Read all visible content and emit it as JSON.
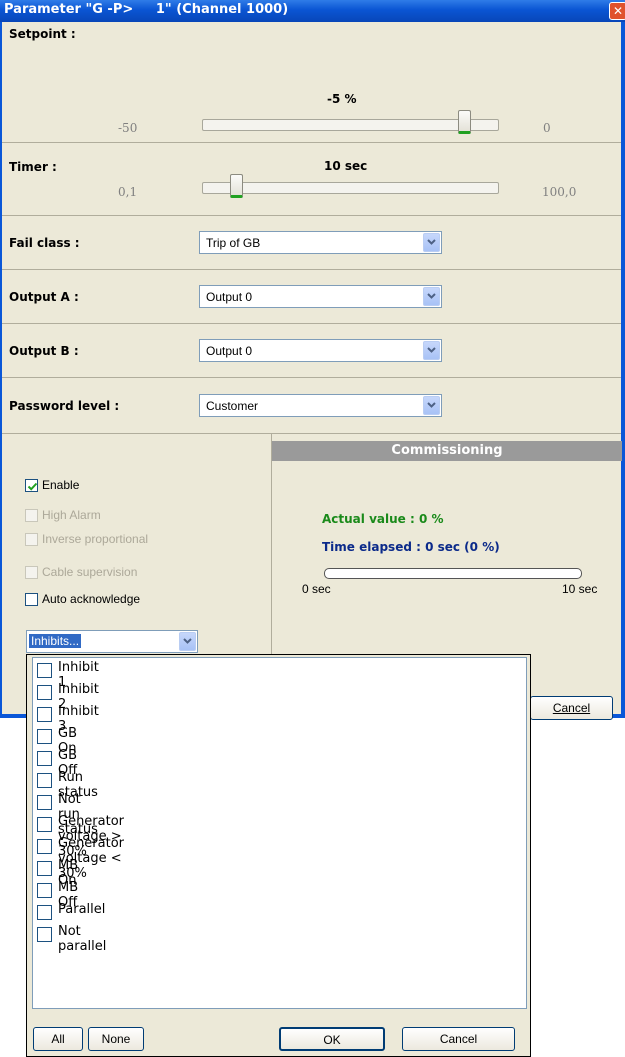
{
  "window": {
    "title": "Parameter \"G -P>     1\" (Channel 1000)",
    "close_symbol": "✕"
  },
  "setpoint": {
    "label": "Setpoint :",
    "value": "-5 %",
    "min": "-50",
    "max": "0",
    "level": 0.9
  },
  "timer": {
    "label": "Timer :",
    "value": "10 sec",
    "min": "0,1",
    "max": "100,0",
    "level": 0.1
  },
  "fields": [
    {
      "label": "Fail class :",
      "value": "Trip of GB"
    },
    {
      "label": "Output A :",
      "value": "Output 0"
    },
    {
      "label": "Output B :",
      "value": "Output 0"
    },
    {
      "label": "Password level :",
      "value": "Customer"
    }
  ],
  "options": {
    "enable": {
      "label": "Enable",
      "checked": true
    },
    "high_alarm": {
      "label": "High Alarm",
      "enabled": false
    },
    "inverse_proportional": {
      "label": "Inverse proportional",
      "enabled": false
    },
    "cable_supervision": {
      "label": "Cable supervision",
      "enabled": false
    },
    "auto_acknowledge": {
      "label": "Auto acknowledge",
      "checked": false
    }
  },
  "inhibits_combo": {
    "value": "Inhibits..."
  },
  "commissioning": {
    "header": "Commissioning",
    "actual_value": "Actual value : 0 %",
    "time_elapsed": "Time elapsed : 0 sec (0 %)",
    "progress_start": "0 sec",
    "progress_end": "10 sec",
    "progress": 0
  },
  "dialog_buttons": {
    "cancel": "Cancel"
  },
  "inhibits_popup": {
    "items": [
      "Inhibit 1",
      "Inhibit 2",
      "Inhibit 3",
      "GB On",
      "GB Off",
      "Run status",
      "Not run status",
      "Generator voltage > 30%",
      "Generator voltage < 30%",
      "MB On",
      "MB Off",
      "Parallel",
      "Not parallel"
    ],
    "all": "All",
    "none": "None",
    "ok": "OK",
    "cancel": "Cancel"
  },
  "colors": {
    "title_bar": "#0a57d8",
    "actual_value": "#1a8a1a",
    "time_elapsed": "#0b2a8a",
    "commissioning_header": "#9a9a9a"
  }
}
